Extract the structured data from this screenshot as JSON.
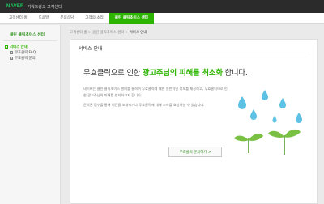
{
  "header": {
    "logo": "NAVER",
    "service": "키워드광고 고객센터"
  },
  "gnb": [
    "고객센터 홈",
    "도움말",
    "문의상담",
    "고객의 소리",
    "클린 클릭초이스 센터"
  ],
  "gnb_active": 4,
  "sidebar": {
    "title": "클린 클릭초이스 센터",
    "items": [
      "서비스 안내",
      "무효클릭 FAQ",
      "무효클릭 문의"
    ],
    "active": 0
  },
  "breadcrumb": {
    "items": [
      "고객센터 홈",
      "클린 클릭초이스 센터"
    ],
    "current": "서비스 안내",
    "separator": ">"
  },
  "page": {
    "title": "서비스 안내",
    "headline_pre": "무효클릭으로 인한 ",
    "headline_highlight": "광고주님의 피해를 최소화",
    "headline_post": " 합니다.",
    "paragraphs": [
      "네이버는 클린 클릭초이스 센터를 통하여 무효클릭에 대한 일반적인 정보를 제공하고, 무효클릭으로 인한 광고주님의 피해를 방지하고자 합니다.",
      "문의된 접수를 통해 의견을 보내시거나 무효클릭에 대해 조사를 요청하실 수 있습니다."
    ],
    "cta_label": "무효클릭 문의하기 >"
  },
  "colors": {
    "accent": "#2db400",
    "header": "#2b2b2b",
    "drop": "#5cc1e2",
    "sprout": "#7ac143"
  }
}
